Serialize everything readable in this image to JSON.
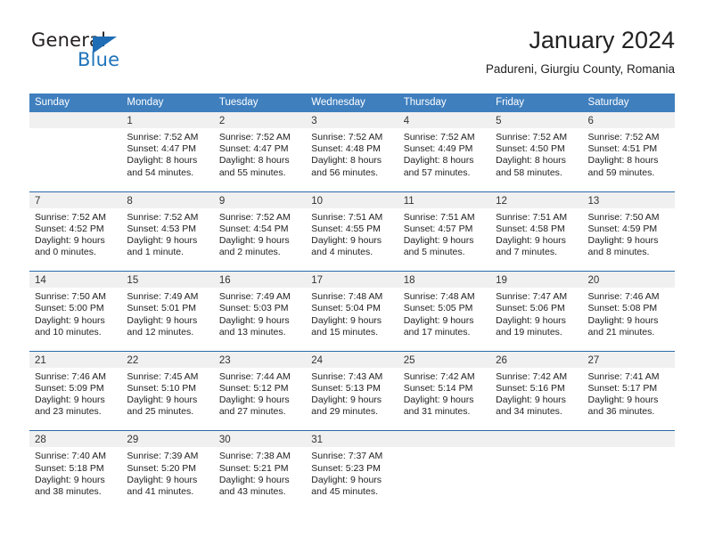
{
  "brand": {
    "name_part1": "General",
    "name_part2": "Blue"
  },
  "header": {
    "month_title": "January 2024",
    "location": "Padureni, Giurgiu County, Romania"
  },
  "colors": {
    "header_blue": "#3f7fbe",
    "row_divider_blue": "#2b6cab",
    "day_band_gray": "#f0f0f0",
    "brand_blue": "#1f74bb"
  },
  "weekdays": [
    "Sunday",
    "Monday",
    "Tuesday",
    "Wednesday",
    "Thursday",
    "Friday",
    "Saturday"
  ],
  "weeks": [
    [
      {
        "day": "",
        "sunrise": "",
        "sunset": "",
        "daylight_line1": "",
        "daylight_line2": ""
      },
      {
        "day": "1",
        "sunrise": "Sunrise: 7:52 AM",
        "sunset": "Sunset: 4:47 PM",
        "daylight_line1": "Daylight: 8 hours",
        "daylight_line2": "and 54 minutes."
      },
      {
        "day": "2",
        "sunrise": "Sunrise: 7:52 AM",
        "sunset": "Sunset: 4:47 PM",
        "daylight_line1": "Daylight: 8 hours",
        "daylight_line2": "and 55 minutes."
      },
      {
        "day": "3",
        "sunrise": "Sunrise: 7:52 AM",
        "sunset": "Sunset: 4:48 PM",
        "daylight_line1": "Daylight: 8 hours",
        "daylight_line2": "and 56 minutes."
      },
      {
        "day": "4",
        "sunrise": "Sunrise: 7:52 AM",
        "sunset": "Sunset: 4:49 PM",
        "daylight_line1": "Daylight: 8 hours",
        "daylight_line2": "and 57 minutes."
      },
      {
        "day": "5",
        "sunrise": "Sunrise: 7:52 AM",
        "sunset": "Sunset: 4:50 PM",
        "daylight_line1": "Daylight: 8 hours",
        "daylight_line2": "and 58 minutes."
      },
      {
        "day": "6",
        "sunrise": "Sunrise: 7:52 AM",
        "sunset": "Sunset: 4:51 PM",
        "daylight_line1": "Daylight: 8 hours",
        "daylight_line2": "and 59 minutes."
      }
    ],
    [
      {
        "day": "7",
        "sunrise": "Sunrise: 7:52 AM",
        "sunset": "Sunset: 4:52 PM",
        "daylight_line1": "Daylight: 9 hours",
        "daylight_line2": "and 0 minutes."
      },
      {
        "day": "8",
        "sunrise": "Sunrise: 7:52 AM",
        "sunset": "Sunset: 4:53 PM",
        "daylight_line1": "Daylight: 9 hours",
        "daylight_line2": "and 1 minute."
      },
      {
        "day": "9",
        "sunrise": "Sunrise: 7:52 AM",
        "sunset": "Sunset: 4:54 PM",
        "daylight_line1": "Daylight: 9 hours",
        "daylight_line2": "and 2 minutes."
      },
      {
        "day": "10",
        "sunrise": "Sunrise: 7:51 AM",
        "sunset": "Sunset: 4:55 PM",
        "daylight_line1": "Daylight: 9 hours",
        "daylight_line2": "and 4 minutes."
      },
      {
        "day": "11",
        "sunrise": "Sunrise: 7:51 AM",
        "sunset": "Sunset: 4:57 PM",
        "daylight_line1": "Daylight: 9 hours",
        "daylight_line2": "and 5 minutes."
      },
      {
        "day": "12",
        "sunrise": "Sunrise: 7:51 AM",
        "sunset": "Sunset: 4:58 PM",
        "daylight_line1": "Daylight: 9 hours",
        "daylight_line2": "and 7 minutes."
      },
      {
        "day": "13",
        "sunrise": "Sunrise: 7:50 AM",
        "sunset": "Sunset: 4:59 PM",
        "daylight_line1": "Daylight: 9 hours",
        "daylight_line2": "and 8 minutes."
      }
    ],
    [
      {
        "day": "14",
        "sunrise": "Sunrise: 7:50 AM",
        "sunset": "Sunset: 5:00 PM",
        "daylight_line1": "Daylight: 9 hours",
        "daylight_line2": "and 10 minutes."
      },
      {
        "day": "15",
        "sunrise": "Sunrise: 7:49 AM",
        "sunset": "Sunset: 5:01 PM",
        "daylight_line1": "Daylight: 9 hours",
        "daylight_line2": "and 12 minutes."
      },
      {
        "day": "16",
        "sunrise": "Sunrise: 7:49 AM",
        "sunset": "Sunset: 5:03 PM",
        "daylight_line1": "Daylight: 9 hours",
        "daylight_line2": "and 13 minutes."
      },
      {
        "day": "17",
        "sunrise": "Sunrise: 7:48 AM",
        "sunset": "Sunset: 5:04 PM",
        "daylight_line1": "Daylight: 9 hours",
        "daylight_line2": "and 15 minutes."
      },
      {
        "day": "18",
        "sunrise": "Sunrise: 7:48 AM",
        "sunset": "Sunset: 5:05 PM",
        "daylight_line1": "Daylight: 9 hours",
        "daylight_line2": "and 17 minutes."
      },
      {
        "day": "19",
        "sunrise": "Sunrise: 7:47 AM",
        "sunset": "Sunset: 5:06 PM",
        "daylight_line1": "Daylight: 9 hours",
        "daylight_line2": "and 19 minutes."
      },
      {
        "day": "20",
        "sunrise": "Sunrise: 7:46 AM",
        "sunset": "Sunset: 5:08 PM",
        "daylight_line1": "Daylight: 9 hours",
        "daylight_line2": "and 21 minutes."
      }
    ],
    [
      {
        "day": "21",
        "sunrise": "Sunrise: 7:46 AM",
        "sunset": "Sunset: 5:09 PM",
        "daylight_line1": "Daylight: 9 hours",
        "daylight_line2": "and 23 minutes."
      },
      {
        "day": "22",
        "sunrise": "Sunrise: 7:45 AM",
        "sunset": "Sunset: 5:10 PM",
        "daylight_line1": "Daylight: 9 hours",
        "daylight_line2": "and 25 minutes."
      },
      {
        "day": "23",
        "sunrise": "Sunrise: 7:44 AM",
        "sunset": "Sunset: 5:12 PM",
        "daylight_line1": "Daylight: 9 hours",
        "daylight_line2": "and 27 minutes."
      },
      {
        "day": "24",
        "sunrise": "Sunrise: 7:43 AM",
        "sunset": "Sunset: 5:13 PM",
        "daylight_line1": "Daylight: 9 hours",
        "daylight_line2": "and 29 minutes."
      },
      {
        "day": "25",
        "sunrise": "Sunrise: 7:42 AM",
        "sunset": "Sunset: 5:14 PM",
        "daylight_line1": "Daylight: 9 hours",
        "daylight_line2": "and 31 minutes."
      },
      {
        "day": "26",
        "sunrise": "Sunrise: 7:42 AM",
        "sunset": "Sunset: 5:16 PM",
        "daylight_line1": "Daylight: 9 hours",
        "daylight_line2": "and 34 minutes."
      },
      {
        "day": "27",
        "sunrise": "Sunrise: 7:41 AM",
        "sunset": "Sunset: 5:17 PM",
        "daylight_line1": "Daylight: 9 hours",
        "daylight_line2": "and 36 minutes."
      }
    ],
    [
      {
        "day": "28",
        "sunrise": "Sunrise: 7:40 AM",
        "sunset": "Sunset: 5:18 PM",
        "daylight_line1": "Daylight: 9 hours",
        "daylight_line2": "and 38 minutes."
      },
      {
        "day": "29",
        "sunrise": "Sunrise: 7:39 AM",
        "sunset": "Sunset: 5:20 PM",
        "daylight_line1": "Daylight: 9 hours",
        "daylight_line2": "and 41 minutes."
      },
      {
        "day": "30",
        "sunrise": "Sunrise: 7:38 AM",
        "sunset": "Sunset: 5:21 PM",
        "daylight_line1": "Daylight: 9 hours",
        "daylight_line2": "and 43 minutes."
      },
      {
        "day": "31",
        "sunrise": "Sunrise: 7:37 AM",
        "sunset": "Sunset: 5:23 PM",
        "daylight_line1": "Daylight: 9 hours",
        "daylight_line2": "and 45 minutes."
      },
      {
        "day": "",
        "sunrise": "",
        "sunset": "",
        "daylight_line1": "",
        "daylight_line2": ""
      },
      {
        "day": "",
        "sunrise": "",
        "sunset": "",
        "daylight_line1": "",
        "daylight_line2": ""
      },
      {
        "day": "",
        "sunrise": "",
        "sunset": "",
        "daylight_line1": "",
        "daylight_line2": ""
      }
    ]
  ]
}
